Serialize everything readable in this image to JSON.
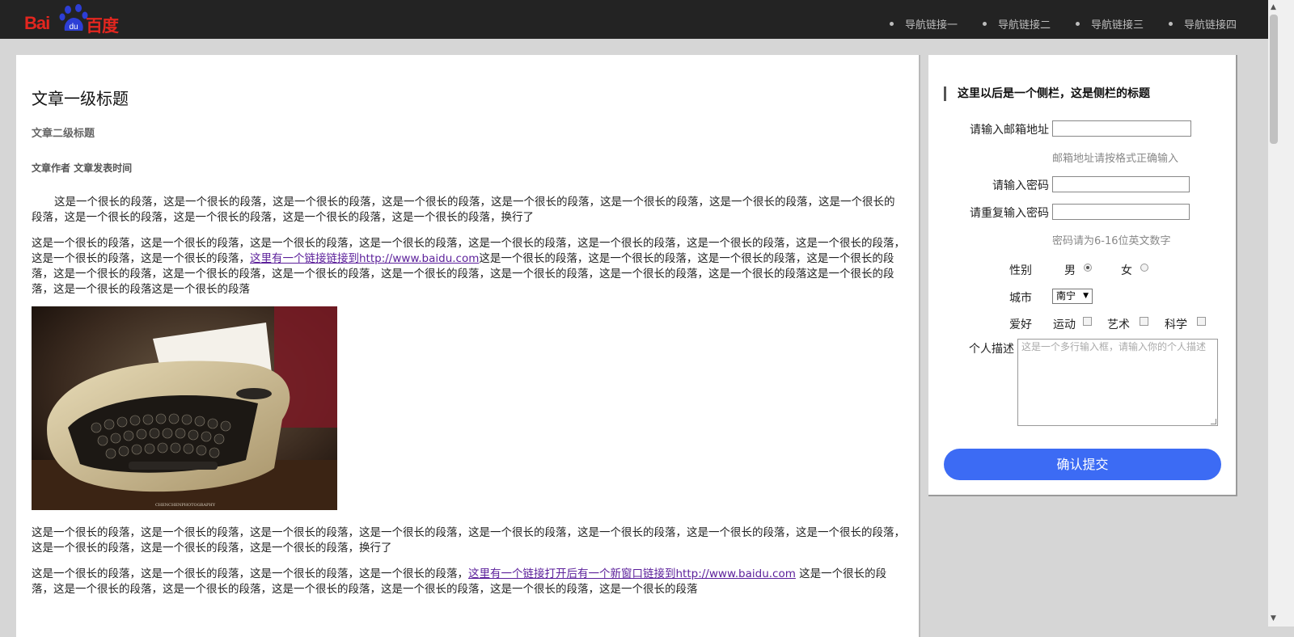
{
  "header": {
    "logo": {
      "latin": "Bai",
      "paw_text": "du",
      "cn": "百度"
    },
    "nav": [
      "导航链接一",
      "导航链接二",
      "导航链接三",
      "导航链接四"
    ]
  },
  "article": {
    "h1": "文章一级标题",
    "h2": "文章二级标题",
    "meta": "文章作者 文章发表时间",
    "p1": "这是一个很长的段落，这是一个很长的段落，这是一个很长的段落，这是一个很长的段落，这是一个很长的段落，这是一个很长的段落，这是一个很长的段落，这是一个很长的段落，这是一个很长的段落，这是一个很长的段落，这是一个很长的段落，这是一个很长的段落，换行了",
    "p2_before": "这是一个很长的段落，这是一个很长的段落，这是一个很长的段落，这是一个很长的段落，这是一个很长的段落，这是一个很长的段落，这是一个很长的段落，这是一个很长的段落，这是一个很长的段落，这是一个很长的段落，",
    "p2_link": "这里有一个链接链接到http://www.baidu.com",
    "p2_after": "这是一个很长的段落，这是一个很长的段落，这是一个很长的段落，这是一个很长的段落，这是一个很长的段落，这是一个很长的段落，这是一个很长的段落，这是一个很长的段落，这是一个很长的段落，这是一个很长的段落，这是一个很长的段落这是一个很长的段落，这是一个很长的段落这是一个很长的段落",
    "image_caption": "CHENCHENPHOTOGRAPHY",
    "p3": "这是一个很长的段落，这是一个很长的段落，这是一个很长的段落，这是一个很长的段落，这是一个很长的段落，这是一个很长的段落，这是一个很长的段落，这是一个很长的段落，这是一个很长的段落，这是一个很长的段落，这是一个很长的段落，换行了",
    "p4_before": "这是一个很长的段落，这是一个很长的段落，这是一个很长的段落，这是一个很长的段落，",
    "p4_link": "这里有一个链接打开后有一个新窗口链接到http://www.baidu.com",
    "p4_after": " 这是一个很长的段落，这是一个很长的段落，这是一个很长的段落，这是一个很长的段落，这是一个很长的段落，这是一个很长的段落，这是一个很长的段落"
  },
  "sidebar": {
    "title": "这里以后是一个侧栏，这是侧栏的标题",
    "email_label": "请输入邮箱地址",
    "email_hint": "邮箱地址请按格式正确输入",
    "password_label": "请输入密码",
    "repeat_label": "请重复输入密码",
    "password_hint": "密码请为6-16位英文数字",
    "gender_label": "性别",
    "gender_male": "男",
    "gender_female": "女",
    "city_label": "城市",
    "city_value": "南宁",
    "hobby_label": "爱好",
    "hobby_sport": "运动",
    "hobby_art": "艺术",
    "hobby_science": "科学",
    "desc_label": "个人描述",
    "desc_placeholder": "这是一个多行输入框，请输入你的个人描述",
    "submit": "确认提交"
  },
  "colors": {
    "topbar": "#232323",
    "brand_red": "#e3261f",
    "submit": "#3c6bf4",
    "link": "#5b1f9a"
  }
}
